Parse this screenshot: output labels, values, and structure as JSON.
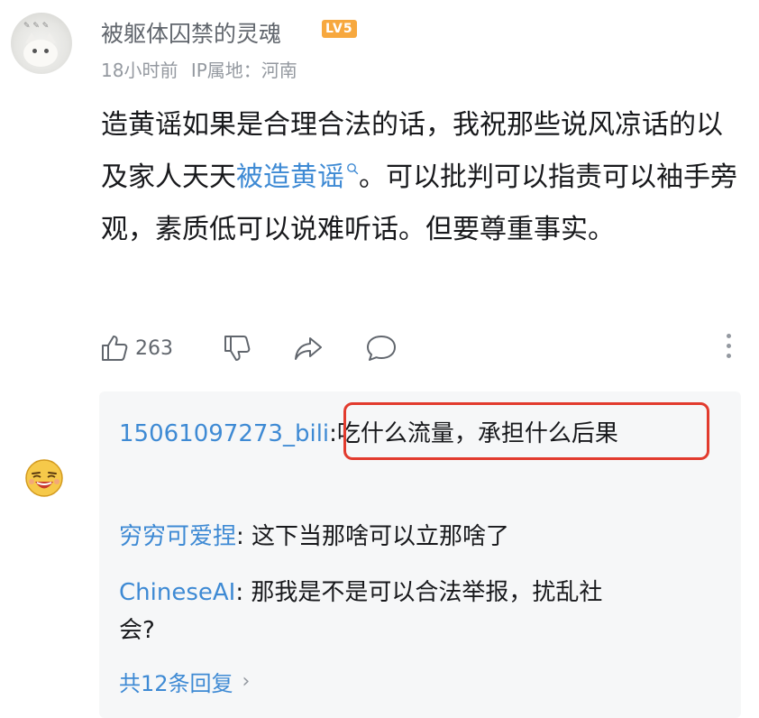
{
  "comment": {
    "username": "被躯体囚禁的灵魂",
    "level": "LV5",
    "time": "18小时前",
    "ip_location": "IP属地：河南",
    "text_before": "造黄谣如果是合理合法的话，我祝那些说风凉话的以及家人天天",
    "link_text": "被造黄谣",
    "text_after": "。可以批判可以指责可以袖手旁观，素质低可以说难听话。但要尊重事实。",
    "likes": "263",
    "colors": {
      "link": "#3e8ad4",
      "level_badge": "#f7a83e",
      "highlight_box": "#e23b2e"
    }
  },
  "replies": {
    "items": [
      {
        "name": "15061097273_bili",
        "text": "吃什么流量，承担什么后果"
      },
      {
        "name": "穷穷可爱捏",
        "text": "这下当那啥可以立那啥了"
      },
      {
        "name": "ChineseAI",
        "text": "那我是不是可以合法举报，扰乱社",
        "text_cont": "会?"
      }
    ],
    "more_label": "共12条回复"
  }
}
